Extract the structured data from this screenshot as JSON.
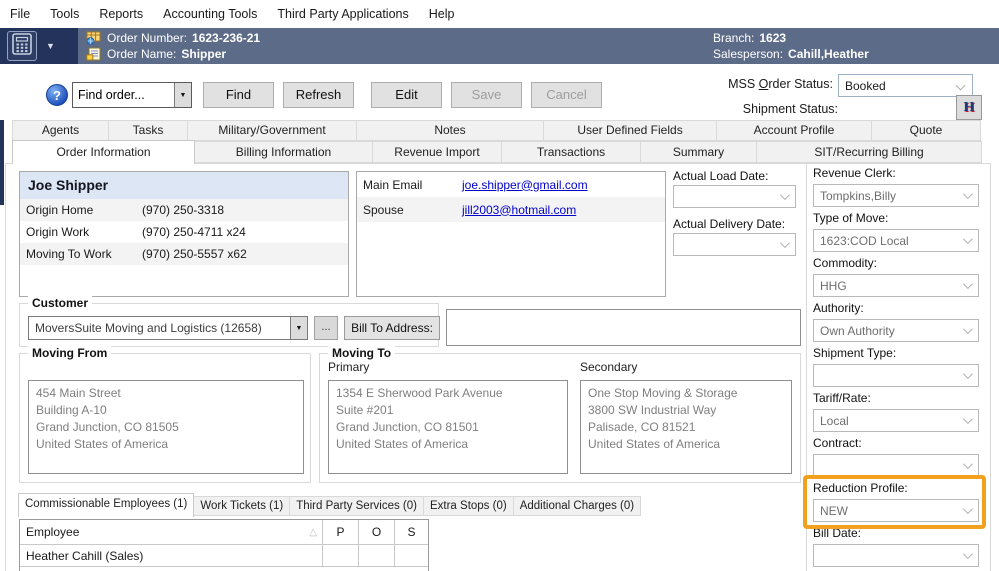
{
  "colors": {
    "header_bg": "#5C6B87",
    "header_left_bg": "#24335B",
    "accent_orange": "#F2A11E",
    "link_blue": "#0000CC",
    "contact_header_bg": "#DCE6F4",
    "tab_inactive_bg": "#F1F1F1",
    "button_bg": "#E1E1E1"
  },
  "icons": {
    "help_glyph": "?",
    "caret_down": "▼",
    "sort_ascending": "△",
    "ellipsis": "..."
  },
  "menu": {
    "items": [
      "File",
      "Tools",
      "Reports",
      "Accounting Tools",
      "Third Party Applications",
      "Help"
    ]
  },
  "header": {
    "order_number_label": "Order Number:",
    "order_number": "1623-236-21",
    "order_name_label": "Order Name:",
    "order_name": "Shipper",
    "branch_label": "Branch:",
    "branch": "1623",
    "salesperson_label": "Salesperson:",
    "salesperson": "Cahill,Heather"
  },
  "toolbar": {
    "find_value": "Find order...",
    "find_button": "Find",
    "refresh_button": "Refresh",
    "edit_button": "Edit",
    "save_button": "Save",
    "cancel_button": "Cancel",
    "mss_label_pre": "MSS ",
    "mss_label_underlined": "O",
    "mss_label_post": "rder Status:",
    "mss_value": "Booked",
    "shipment_status_label": "Shipment Status:",
    "h_button": "H"
  },
  "tabs": {
    "row1": [
      "Agents",
      "Tasks",
      "Military/Government",
      "Notes",
      "User Defined Fields",
      "Account Profile",
      "Quote"
    ],
    "row2": [
      "Order Information",
      "Billing Information",
      "Revenue Import",
      "Transactions",
      "Summary",
      "SIT/Recurring Billing"
    ],
    "active": "Order Information"
  },
  "contact": {
    "name": "Joe Shipper",
    "phones": [
      {
        "label": "Origin Home",
        "value": "(970) 250-3318"
      },
      {
        "label": "Origin Work",
        "value": "(970) 250-4711 x24"
      },
      {
        "label": "Moving To Work",
        "value": "(970) 250-5557 x62"
      }
    ],
    "emails": [
      {
        "label": "Main Email",
        "value": "joe.shipper@gmail.com"
      },
      {
        "label": "Spouse",
        "value": "jill2003@hotmail.com"
      }
    ]
  },
  "dates": {
    "actual_load_label": "Actual Load Date:",
    "actual_load_value": "",
    "actual_delivery_label": "Actual Delivery Date:",
    "actual_delivery_value": ""
  },
  "right_fields": {
    "items": [
      {
        "label": "Revenue Clerk:",
        "value": "Tompkins,Billy"
      },
      {
        "label": "Type of Move:",
        "value": "1623:COD Local"
      },
      {
        "label": "Commodity:",
        "value": "HHG"
      },
      {
        "label": "Authority:",
        "value": "Own Authority"
      },
      {
        "label": "Shipment Type:",
        "value": ""
      },
      {
        "label": "Tariff/Rate:",
        "value": "Local"
      },
      {
        "label": "Contract:",
        "value": ""
      },
      {
        "label": "Reduction Profile:",
        "value": "NEW",
        "highlighted": true
      },
      {
        "label": "Bill Date:",
        "value": ""
      }
    ]
  },
  "customer": {
    "legend": "Customer",
    "value": "MoversSuite Moving and Logistics (12658)",
    "bill_to_button": "Bill To Address:",
    "bill_to_value": ""
  },
  "moving_from": {
    "legend": "Moving From",
    "address": [
      "454 Main Street",
      "Building A-10",
      "Grand Junction, CO 81505",
      "United States of America"
    ]
  },
  "moving_to": {
    "legend": "Moving To",
    "primary_label": "Primary",
    "primary": [
      "1354 E Sherwood Park Avenue",
      "Suite #201",
      "Grand Junction, CO 81501",
      "United States of America"
    ],
    "secondary_label": "Secondary",
    "secondary": [
      "One Stop Moving & Storage",
      "3800 SW Industrial Way",
      "Palisade, CO 81521",
      "United States of America"
    ]
  },
  "bottom_tabs": {
    "items": [
      "Commissionable Employees (1)",
      "Work Tickets (1)",
      "Third Party Services (0)",
      "Extra Stops (0)",
      "Additional Charges (0)"
    ],
    "active": "Commissionable Employees (1)"
  },
  "employees_table": {
    "columns": [
      "Employee",
      "P",
      "O",
      "S"
    ],
    "rows": [
      {
        "employee": "Heather Cahill (Sales)",
        "p": "",
        "o": "",
        "s": ""
      }
    ]
  }
}
